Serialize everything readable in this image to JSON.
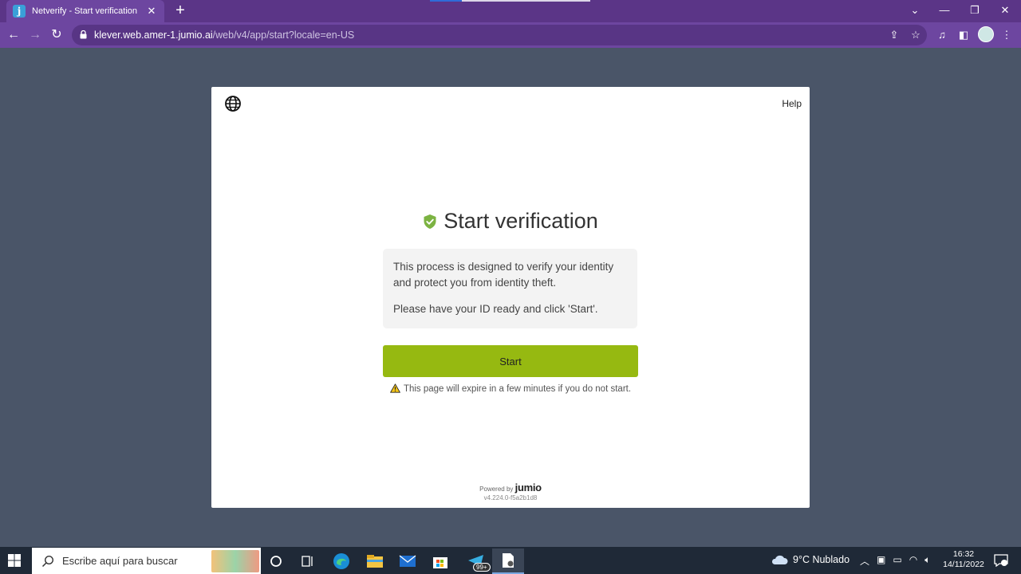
{
  "browser": {
    "tab_title": "Netverify - Start verification",
    "tab_favicon": "j",
    "tab_close": "✕",
    "new_tab": "+",
    "url_host": "klever.web.amer-1.jumio.ai",
    "url_path": "/web/v4/app/start?locale=en-US",
    "icons": [
      "back-icon",
      "forward-icon",
      "reload-icon",
      "lock-icon",
      "share-icon",
      "star-icon",
      "media-icon",
      "sidepanel-icon",
      "profile-avatar",
      "menu-icon"
    ]
  },
  "page": {
    "help_label": "Help",
    "title": "Start verification",
    "info_paragraph_1": "This process is designed to verify your identity and protect you from identity theft.",
    "info_paragraph_2": "Please have your ID ready and click 'Start'.",
    "start_label": "Start",
    "warning_text": "This page will expire in a few minutes if you do not start.",
    "powered_by": "Powered by",
    "brand": "jumio",
    "version": "v4.224.0-f5a2b1d8",
    "colors": {
      "accent": "#96b911",
      "shield": "#7cb342",
      "card_bg": "#ffffff",
      "backdrop": "#4a5568"
    }
  },
  "taskbar": {
    "search_placeholder": "Escribe aquí para buscar",
    "badge": "99+",
    "weather": "9°C  Nublado",
    "time": "16:32",
    "date": "14/11/2022"
  }
}
